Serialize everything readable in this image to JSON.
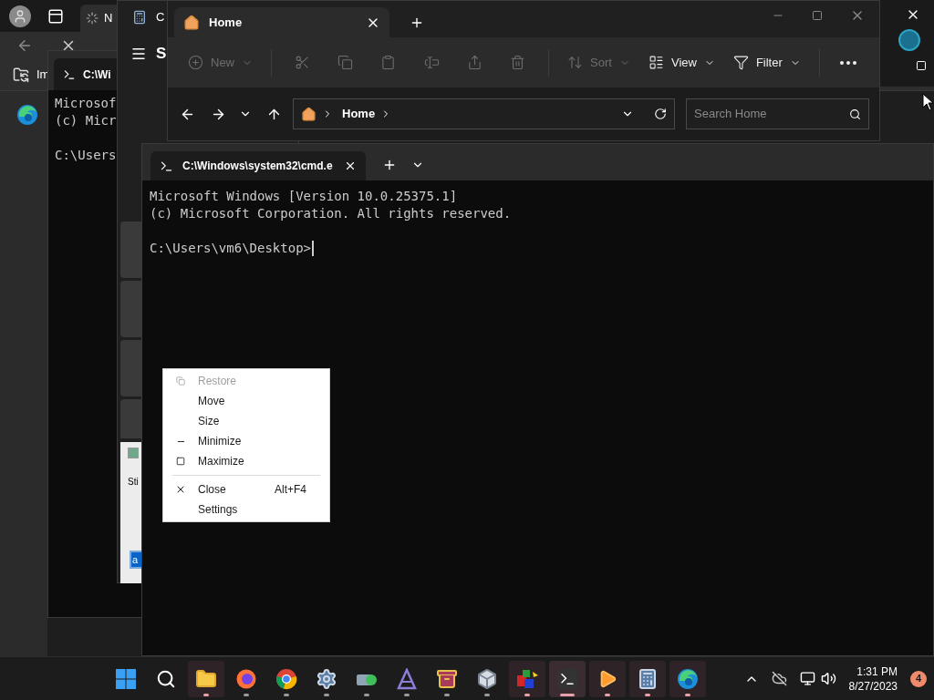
{
  "browser": {
    "tab_title": "N",
    "favorites_item": "Im"
  },
  "console_window": {
    "title": "C:\\Wi",
    "blocks": [
      [
        "Microsof",
        "(c) Micr"
      ],
      [
        "C:\\Users"
      ]
    ]
  },
  "calculator_window": {
    "title": "C",
    "heading": "S"
  },
  "dialog": {
    "text": "Sti",
    "button": "a"
  },
  "explorer": {
    "tabs": [
      {
        "label": "Home",
        "selected": true
      }
    ],
    "toolbar": [
      {
        "kind": "new",
        "label": "New",
        "disabled": true
      },
      {
        "kind": "separator"
      },
      {
        "kind": "cut",
        "disabled": true
      },
      {
        "kind": "copy",
        "disabled": true
      },
      {
        "kind": "paste",
        "disabled": true
      },
      {
        "kind": "rename",
        "disabled": true
      },
      {
        "kind": "share",
        "disabled": true
      },
      {
        "kind": "delete",
        "disabled": true
      },
      {
        "kind": "separator"
      },
      {
        "kind": "sort",
        "label": "Sort",
        "disabled": true
      },
      {
        "kind": "view",
        "label": "View",
        "disabled": false
      },
      {
        "kind": "filter",
        "label": "Filter",
        "disabled": false
      },
      {
        "kind": "separator"
      },
      {
        "kind": "more",
        "disabled": false
      }
    ],
    "breadcrumb": "Home",
    "search": {
      "placeholder": "Search Home"
    }
  },
  "terminal": {
    "tab": "C:\\Windows\\system32\\cmd.e",
    "blocks": [
      [
        "Microsoft Windows [Version 10.0.25375.1]",
        "(c) Microsoft Corporation. All rights reserved."
      ],
      [
        "C:\\Users\\vm6\\Desktop>"
      ]
    ],
    "cursor": true
  },
  "context_menu": {
    "items": [
      {
        "kind": "restore",
        "label": "Restore",
        "disabled": true
      },
      {
        "kind": "move",
        "label": "Move",
        "disabled": false
      },
      {
        "kind": "size",
        "label": "Size",
        "disabled": false
      },
      {
        "kind": "minimize",
        "label": "Minimize",
        "disabled": false
      },
      {
        "kind": "maximize",
        "label": "Maximize",
        "disabled": false
      },
      {
        "kind": "separator"
      },
      {
        "kind": "close",
        "label": "Close",
        "shortcut": "Alt+F4",
        "disabled": false
      },
      {
        "kind": "settings",
        "label": "Settings",
        "disabled": false
      }
    ]
  },
  "taskbar": {
    "apps": [
      {
        "kind": "start",
        "running": false,
        "open": false,
        "focused": false
      },
      {
        "kind": "search",
        "running": false,
        "open": false,
        "focused": false
      },
      {
        "kind": "folder",
        "running": true,
        "open": true,
        "focused": false
      },
      {
        "kind": "firefox",
        "running": true,
        "open": false,
        "focused": false
      },
      {
        "kind": "chrome",
        "running": true,
        "open": false,
        "focused": false
      },
      {
        "kind": "gear",
        "running": true,
        "open": false,
        "focused": false
      },
      {
        "kind": "network",
        "running": true,
        "open": false,
        "focused": false
      },
      {
        "kind": "triangle",
        "running": true,
        "open": false,
        "focused": false
      },
      {
        "kind": "archive",
        "running": true,
        "open": false,
        "focused": false
      },
      {
        "kind": "cube",
        "running": true,
        "open": false,
        "focused": false
      },
      {
        "kind": "blocks",
        "running": true,
        "open": true,
        "focused": false
      },
      {
        "kind": "terminal",
        "running": true,
        "open": true,
        "focused": true
      },
      {
        "kind": "media",
        "running": true,
        "open": true,
        "focused": false
      },
      {
        "kind": "calculator",
        "running": true,
        "open": true,
        "focused": false
      },
      {
        "kind": "edge",
        "running": true,
        "open": true,
        "focused": false
      }
    ],
    "time": "1:31 PM",
    "date": "8/27/2023",
    "badge": "4"
  }
}
